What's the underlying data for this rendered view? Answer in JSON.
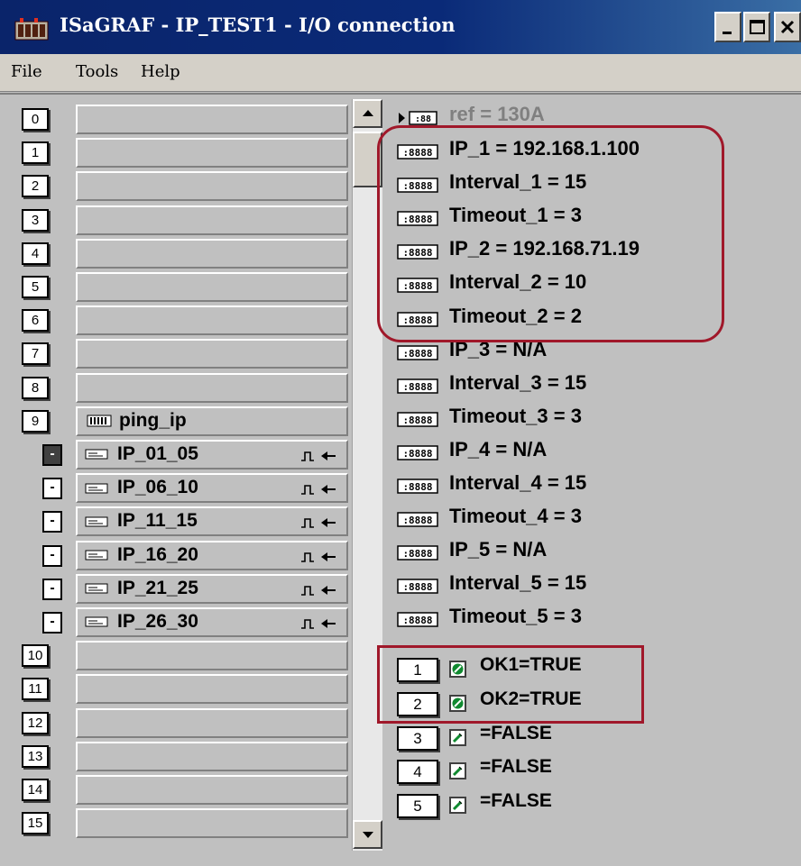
{
  "window": {
    "title": "ISaGRAF - IP_TEST1 - I/O connection",
    "buttons": [
      "minimize",
      "maximize",
      "close"
    ]
  },
  "menu": {
    "file": "File",
    "tools": "Tools",
    "help": "Help"
  },
  "slots": [
    {
      "num": "0",
      "label": ""
    },
    {
      "num": "1",
      "label": ""
    },
    {
      "num": "2",
      "label": ""
    },
    {
      "num": "3",
      "label": ""
    },
    {
      "num": "4",
      "label": ""
    },
    {
      "num": "5",
      "label": ""
    },
    {
      "num": "6",
      "label": ""
    },
    {
      "num": "7",
      "label": ""
    },
    {
      "num": "8",
      "label": ""
    },
    {
      "num": "9",
      "label": "ping_ip"
    },
    {
      "num": "10",
      "label": ""
    },
    {
      "num": "11",
      "label": ""
    },
    {
      "num": "12",
      "label": ""
    },
    {
      "num": "13",
      "label": ""
    },
    {
      "num": "14",
      "label": ""
    },
    {
      "num": "15",
      "label": ""
    }
  ],
  "sub_boards": [
    {
      "label": "IP_01_05",
      "active": true
    },
    {
      "label": "IP_06_10",
      "active": false
    },
    {
      "label": "IP_11_15",
      "active": false
    },
    {
      "label": "IP_16_20",
      "active": false
    },
    {
      "label": "IP_21_25",
      "active": false
    },
    {
      "label": "IP_26_30",
      "active": false
    }
  ],
  "sub_button_glyph": "-",
  "variables": {
    "ref": "ref = 130A",
    "items": [
      "IP_1 = 192.168.1.100",
      "Interval_1 = 15",
      "Timeout_1 = 3",
      "IP_2 = 192.168.71.19",
      "Interval_2 = 10",
      "Timeout_2 = 2",
      "IP_3 = N/A",
      "Interval_3 = 15",
      "Timeout_3 = 3",
      "IP_4 = N/A",
      "Interval_4 = 15",
      "Timeout_4 = 3",
      "IP_5 = N/A",
      "Interval_5 = 15",
      "Timeout_5 = 3"
    ]
  },
  "booleans": [
    {
      "num": "1",
      "text": "OK1=TRUE",
      "state": true
    },
    {
      "num": "2",
      "text": "OK2=TRUE",
      "state": true
    },
    {
      "num": "3",
      "text": "=FALSE",
      "state": false
    },
    {
      "num": "4",
      "text": "=FALSE",
      "state": false
    },
    {
      "num": "5",
      "text": "=FALSE",
      "state": false
    }
  ],
  "colors": {
    "title_bar": "#0a246a",
    "face": "#c0c0c0",
    "highlight": "#a0182a",
    "bool_true": "#108a30"
  }
}
